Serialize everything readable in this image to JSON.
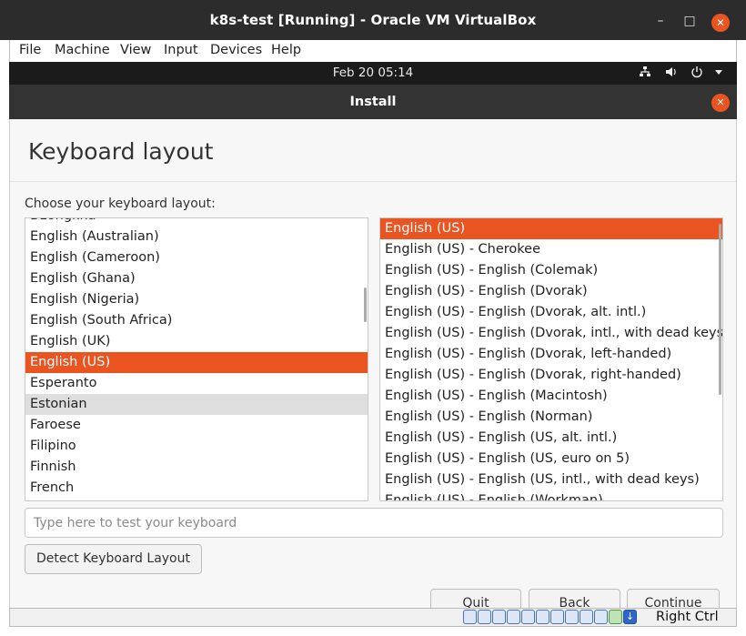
{
  "window": {
    "title": "k8s-test [Running] - Oracle VM VirtualBox"
  },
  "menubar": {
    "items": [
      "File",
      "Machine",
      "View",
      "Input",
      "Devices",
      "Help"
    ]
  },
  "guest_panel": {
    "clock": "Feb 20  05:14"
  },
  "installer": {
    "title": "Install",
    "heading": "Keyboard layout",
    "prompt": "Choose your keyboard layout:",
    "layouts": [
      "Dzongkha",
      "English (Australian)",
      "English (Cameroon)",
      "English (Ghana)",
      "English (Nigeria)",
      "English (South Africa)",
      "English (UK)",
      "English (US)",
      "Esperanto",
      "Estonian",
      "Faroese",
      "Filipino",
      "Finnish",
      "French"
    ],
    "layouts_selected": "English (US)",
    "layouts_hovered": "Estonian",
    "variants": [
      "English (US)",
      "English (US) - Cherokee",
      "English (US) - English (Colemak)",
      "English (US) - English (Dvorak)",
      "English (US) - English (Dvorak, alt. intl.)",
      "English (US) - English (Dvorak, intl., with dead keys)",
      "English (US) - English (Dvorak, left-handed)",
      "English (US) - English (Dvorak, right-handed)",
      "English (US) - English (Macintosh)",
      "English (US) - English (Norman)",
      "English (US) - English (US, alt. intl.)",
      "English (US) - English (US, euro on 5)",
      "English (US) - English (US, intl., with dead keys)",
      "English (US) - English (Workman)"
    ],
    "variants_selected": "English (US)",
    "test_placeholder": "Type here to test your keyboard",
    "detect_label": "Detect Keyboard Layout",
    "quit_label": "Quit",
    "back_label": "Back",
    "continue_label": "Continue"
  },
  "statusbar": {
    "host_key": "Right Ctrl"
  },
  "colors": {
    "accent": "#e95420",
    "panel": "#1b1b1b",
    "header": "#333333"
  }
}
